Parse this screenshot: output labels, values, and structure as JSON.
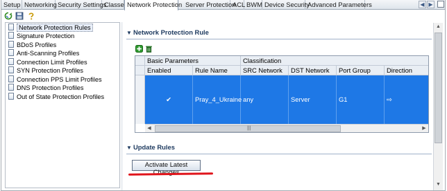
{
  "tabs": [
    {
      "label": "Setup",
      "active": false
    },
    {
      "label": "Networking",
      "active": false
    },
    {
      "label": "Security Settings",
      "active": false
    },
    {
      "label": "Classes",
      "active": false
    },
    {
      "label": "Network Protection",
      "active": true
    },
    {
      "label": "Server Protection",
      "active": false
    },
    {
      "label": "ACL",
      "active": false
    },
    {
      "label": "BWM",
      "active": false
    },
    {
      "label": "Device Security",
      "active": false
    },
    {
      "label": "Advanced Parameters",
      "active": false
    }
  ],
  "toolbar_icons": [
    "refresh-icon",
    "save-icon",
    "help-icon"
  ],
  "sidebar": {
    "items": [
      {
        "label": "Network Protection Rules",
        "selected": true
      },
      {
        "label": "Signature Protection"
      },
      {
        "label": "BDoS Profiles"
      },
      {
        "label": "Anti-Scanning Profiles"
      },
      {
        "label": "Connection Limit Profiles"
      },
      {
        "label": "SYN Protection Profiles"
      },
      {
        "label": "Connection PPS Limit Profiles"
      },
      {
        "label": "DNS Protection Profiles"
      },
      {
        "label": "Out of State Protection Profiles"
      }
    ]
  },
  "main": {
    "section_title": "Network Protection Rule",
    "update_title": "Update Rules",
    "activate_label": "Activate Latest Changes",
    "grid": {
      "groups": [
        "Basic Parameters",
        "Classification"
      ],
      "columns": [
        "Enabled",
        "Rule Name",
        "SRC Network",
        "DST Network",
        "Port Group",
        "Direction"
      ],
      "rows": [
        {
          "enabled": "✔",
          "rule_name": "Pray_4_Ukraine",
          "src": "any",
          "dst": "Server",
          "port_group": "G1",
          "direction": "⇨"
        }
      ]
    }
  },
  "colors": {
    "selection": "#1e78e6",
    "annotation_underline": "#e0141b",
    "section_text": "#1f3b60"
  }
}
